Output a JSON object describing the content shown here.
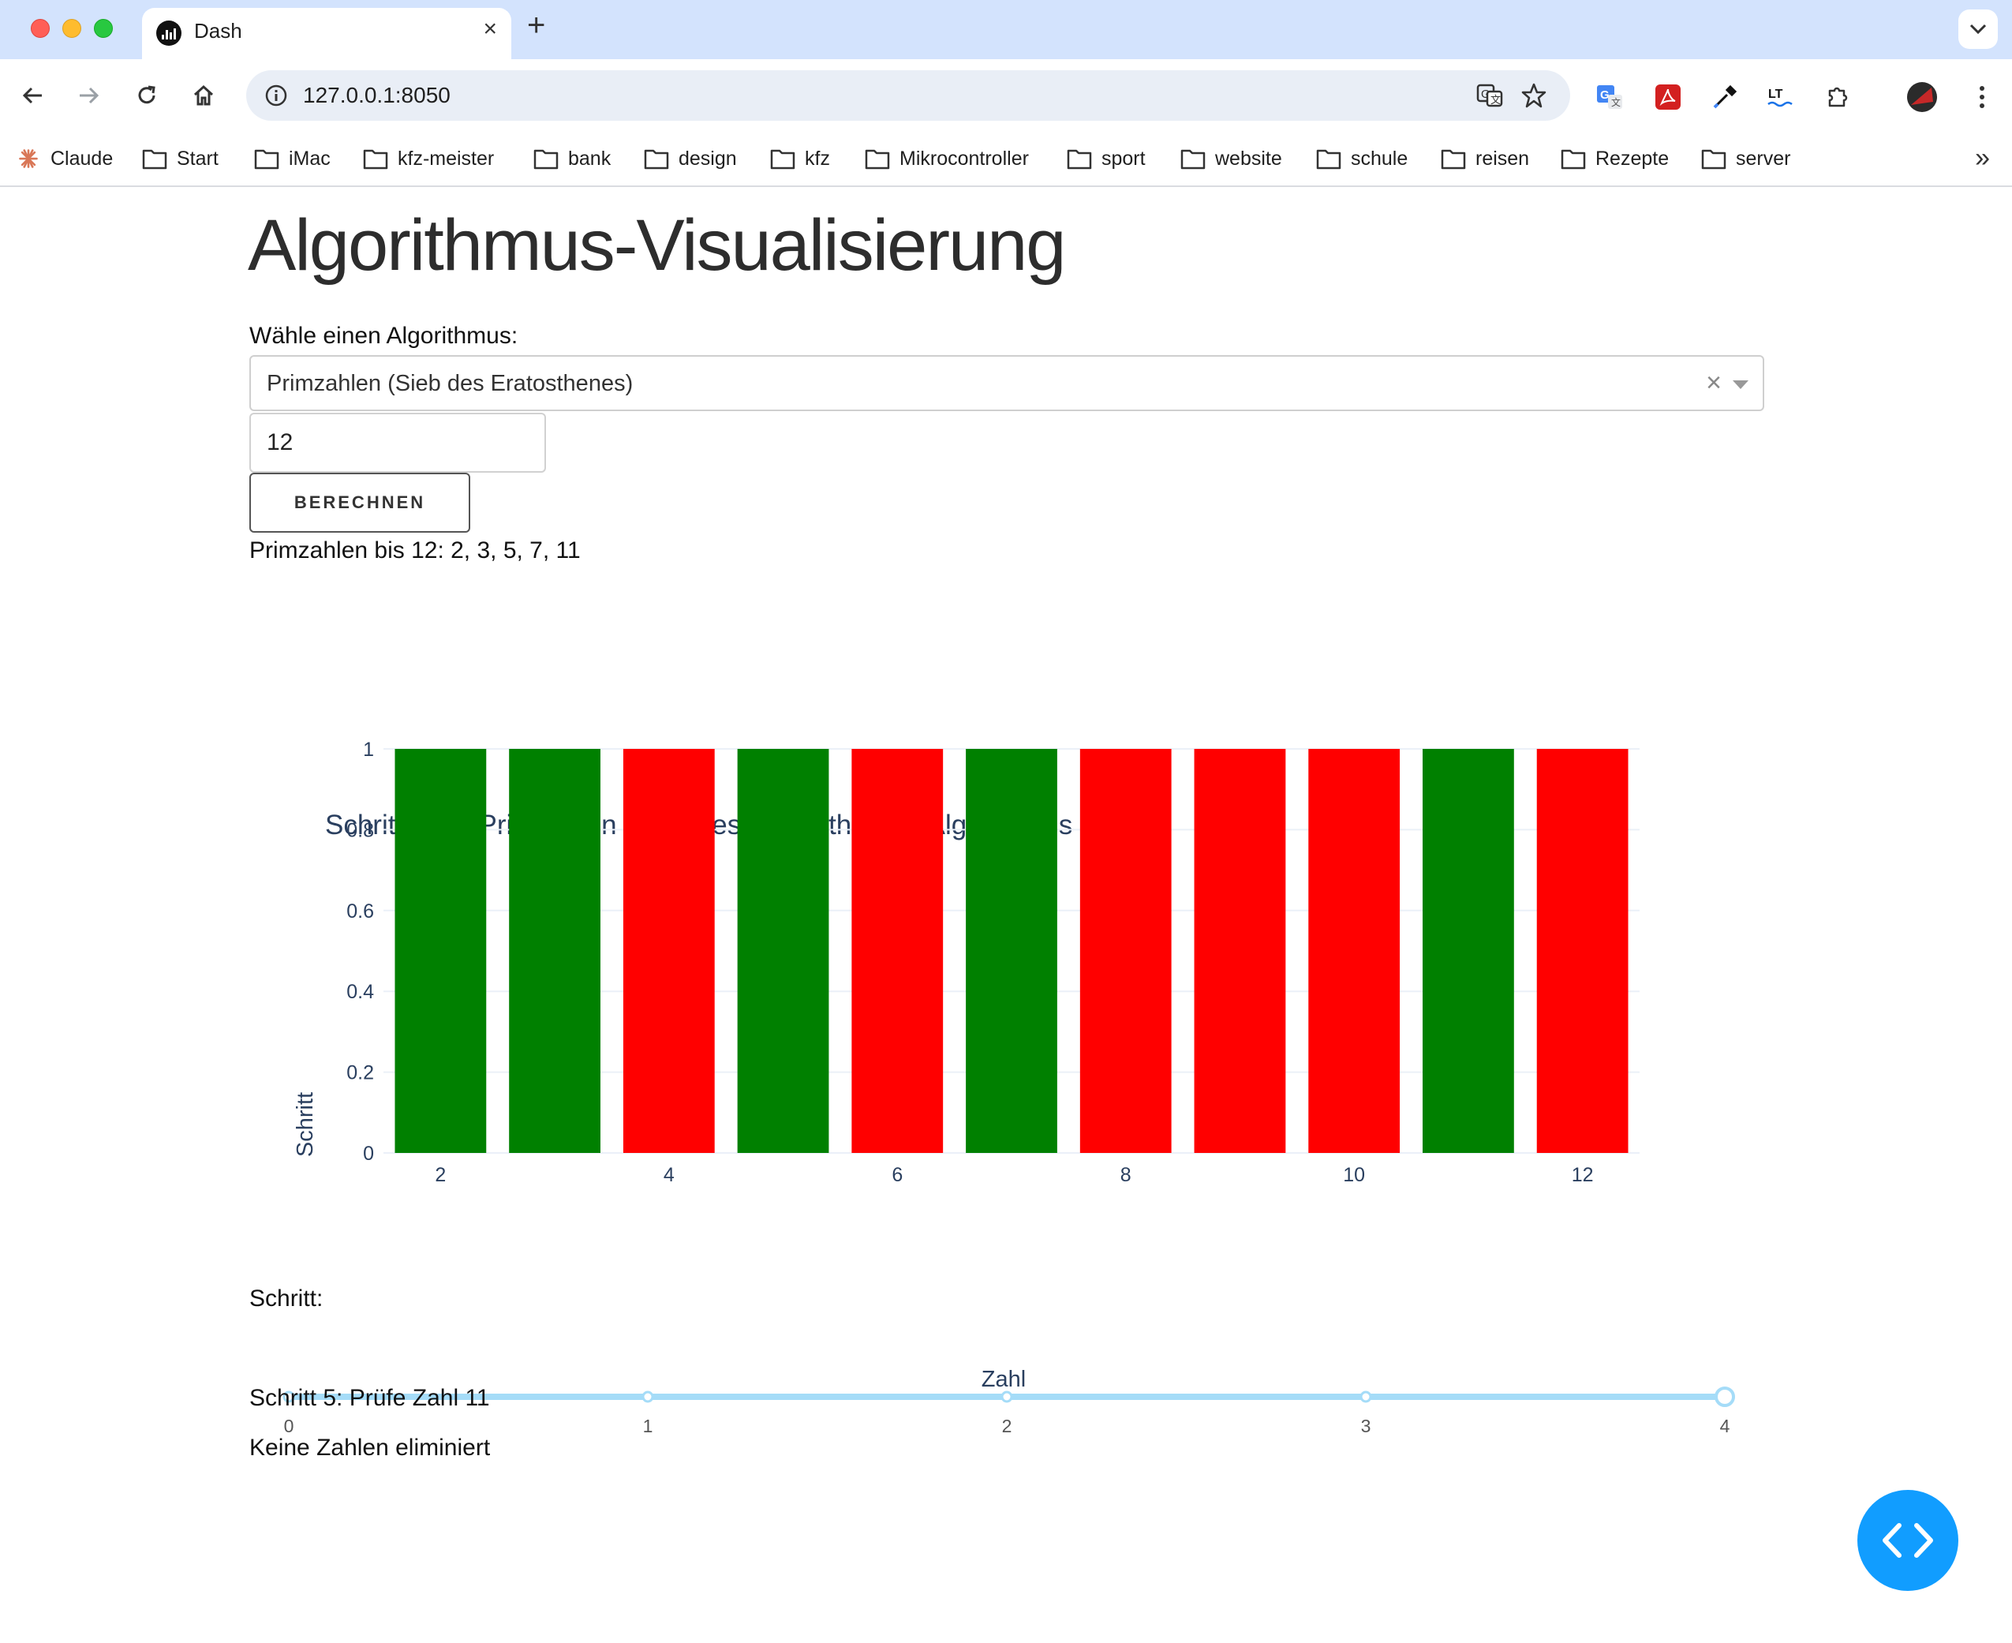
{
  "browser": {
    "tab_title": "Dash",
    "url": "127.0.0.1:8050",
    "bookmarks": [
      "Claude",
      "Start",
      "iMac",
      "kfz-meister",
      "bank",
      "design",
      "kfz",
      "Mikrocontroller",
      "sport",
      "website",
      "schule",
      "reisen",
      "Rezepte",
      "server"
    ],
    "extensions": [
      "google-translate-icon",
      "acrobat-icon",
      "eyedropper-icon",
      "languagetool-icon",
      "puzzle-icon",
      "profile-avatar"
    ]
  },
  "app": {
    "heading": "Algorithmus-Visualisierung",
    "select_label": "Wähle einen Algorithmus:",
    "algorithm_value": "Primzahlen (Sieb des Eratosthenes)",
    "number_value": "12",
    "calc_button": "BERECHNEN",
    "result_text": "Primzahlen bis 12: 2, 3, 5, 7, 11",
    "slider_label": "Schritt:",
    "step_text": "Schritt 5: Prüfe Zahl 11",
    "elim_text": "Keine Zahlen eliminiert"
  },
  "chart_data": {
    "type": "bar",
    "title": "Schritte des Primzahlen (Sieb des Eratosthenes) Algorithmus",
    "xlabel": "Zahl",
    "ylabel": "Schritt",
    "x": [
      2,
      3,
      4,
      5,
      6,
      7,
      8,
      9,
      10,
      11,
      12
    ],
    "values": [
      1,
      1,
      1,
      1,
      1,
      1,
      1,
      1,
      1,
      1,
      1
    ],
    "colors": [
      "green",
      "green",
      "red",
      "green",
      "red",
      "green",
      "red",
      "red",
      "red",
      "green",
      "red"
    ],
    "color_hex": {
      "green": "#008000",
      "red": "#ff0000"
    },
    "ylim": [
      0,
      1
    ],
    "yticks": [
      "0",
      "0.2",
      "0.4",
      "0.6",
      "0.8",
      "1"
    ],
    "xticks": [
      "2",
      "4",
      "6",
      "8",
      "10",
      "12"
    ],
    "grid": true
  },
  "slider": {
    "marks": [
      "0",
      "1",
      "2",
      "3",
      "4"
    ],
    "value": 4,
    "color": "#a5dcf8"
  }
}
